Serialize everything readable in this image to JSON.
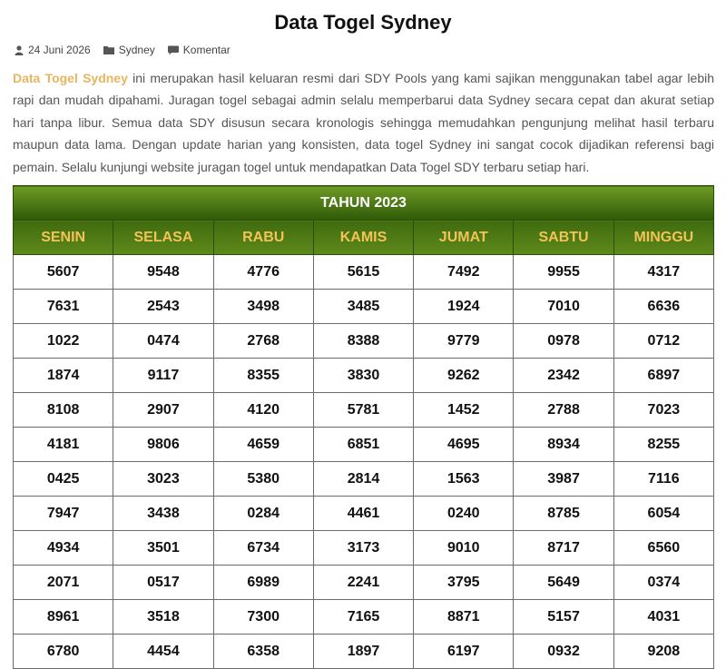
{
  "page": {
    "title": "Data Togel Sydney",
    "meta": {
      "date": "24 Juni 2026",
      "category": "Sydney",
      "comments": "Komentar"
    },
    "intro": {
      "link_text": "Data Togel Sydney",
      "body": " ini merupakan hasil keluaran resmi dari SDY Pools yang kami sajikan menggunakan tabel agar lebih rapi dan mudah dipahami. Juragan togel sebagai admin selalu memperbarui data Sydney secara cepat dan akurat setiap hari tanpa libur. Semua data SDY disusun secara kronologis sehingga memudahkan pengunjung melihat hasil terbaru maupun data lama. Dengan update harian yang konsisten, data togel Sydney ini sangat cocok dijadikan referensi bagi pemain. Selalu kunjungi website juragan togel untuk mendapatkan Data Togel SDY terbaru setiap hari."
    },
    "accent_color": "#e8b55e",
    "header_green": "#4a7a12",
    "header_text_color": "#f4c257"
  },
  "table": {
    "year_label": "TAHUN 2023",
    "days": [
      "SENIN",
      "SELASA",
      "RABU",
      "KAMIS",
      "JUMAT",
      "SABTU",
      "MINGGU"
    ],
    "rows": [
      [
        "5607",
        "9548",
        "4776",
        "5615",
        "7492",
        "9955",
        "4317"
      ],
      [
        "7631",
        "2543",
        "3498",
        "3485",
        "1924",
        "7010",
        "6636"
      ],
      [
        "1022",
        "0474",
        "2768",
        "8388",
        "9779",
        "0978",
        "0712"
      ],
      [
        "1874",
        "9117",
        "8355",
        "3830",
        "9262",
        "2342",
        "6897"
      ],
      [
        "8108",
        "2907",
        "4120",
        "5781",
        "1452",
        "2788",
        "7023"
      ],
      [
        "4181",
        "9806",
        "4659",
        "6851",
        "4695",
        "8934",
        "8255"
      ],
      [
        "0425",
        "3023",
        "5380",
        "2814",
        "1563",
        "3987",
        "7116"
      ],
      [
        "7947",
        "3438",
        "0284",
        "4461",
        "0240",
        "8785",
        "6054"
      ],
      [
        "4934",
        "3501",
        "6734",
        "3173",
        "9010",
        "8717",
        "6560"
      ],
      [
        "2071",
        "0517",
        "6989",
        "2241",
        "3795",
        "5649",
        "0374"
      ],
      [
        "8961",
        "3518",
        "7300",
        "7165",
        "8871",
        "5157",
        "4031"
      ],
      [
        "6780",
        "4454",
        "6358",
        "1897",
        "6197",
        "0932",
        "9208"
      ]
    ]
  }
}
